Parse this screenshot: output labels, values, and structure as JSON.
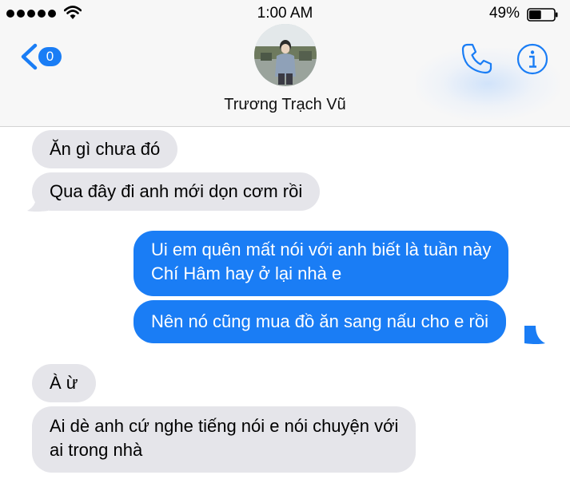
{
  "status_bar": {
    "time": "1:00 AM",
    "battery_percent": "49%",
    "battery_level": 0.49,
    "signal_bars": 5,
    "icons": [
      "signal-dots-icon",
      "wifi-icon",
      "battery-icon"
    ]
  },
  "header": {
    "back_badge": "0",
    "contact_name": "Trương Trạch Vũ",
    "icons": [
      "chevron-left-icon",
      "phone-icon",
      "info-icon"
    ]
  },
  "colors": {
    "accent": "#1a7df5",
    "received_bubble": "#e5e5ea",
    "header_bg": "#f7f7f7"
  },
  "messages": [
    {
      "side": "received",
      "text": "Ăn gì chưa đó"
    },
    {
      "side": "received",
      "text": "Qua đây đi anh mới dọn cơm rồi"
    },
    {
      "side": "sent",
      "lines": [
        "Ui em quên mất nói với anh biết là tuần này",
        "Chí Hâm hay ở lại nhà e"
      ]
    },
    {
      "side": "sent",
      "text": "Nên nó cũng mua đồ ăn sang nấu cho e rồi"
    },
    {
      "side": "received",
      "text": "À ừ"
    },
    {
      "side": "received",
      "lines": [
        "Ai dè anh cứ nghe tiếng nói e nói chuyện với",
        "ai trong nhà"
      ]
    }
  ]
}
